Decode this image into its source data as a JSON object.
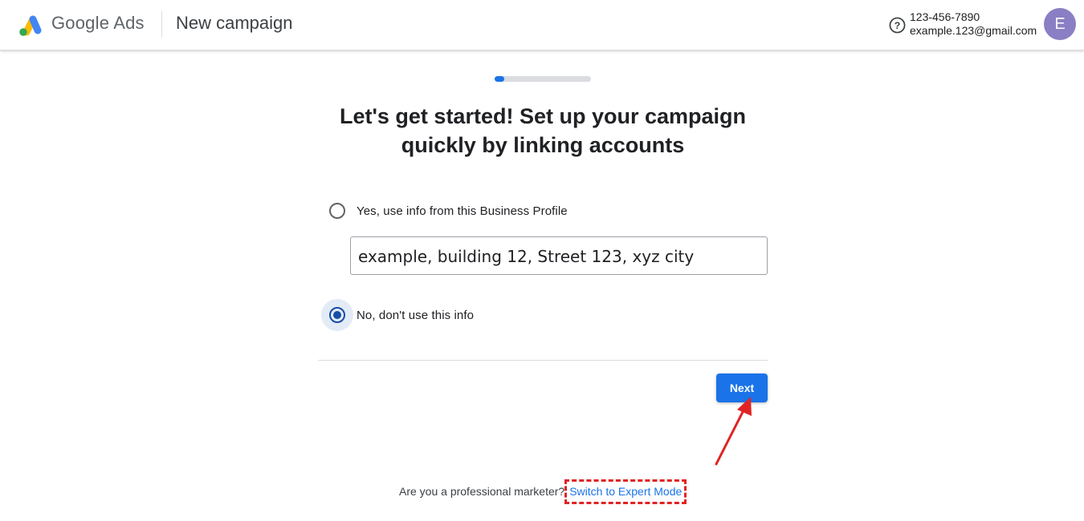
{
  "header": {
    "brand": "Google Ads",
    "page_title": "New campaign",
    "account_phone": "123-456-7890",
    "account_email": "example.123@gmail.com",
    "avatar_initial": "E"
  },
  "progress": {
    "fraction": 0.1
  },
  "main": {
    "headline_line1": "Let's get started! Set up your campaign",
    "headline_line2": "quickly by linking accounts",
    "options": [
      {
        "label": "Yes, use info from this Business Profile",
        "selected": false
      },
      {
        "label": "No, don't use this info",
        "selected": true
      }
    ],
    "business_address": "example, building 12, Street 123, xyz city",
    "next_label": "Next"
  },
  "footer": {
    "question": "Are you a professional marketer?",
    "link_label": "Switch to Expert Mode"
  },
  "colors": {
    "primary_blue": "#1a73e8",
    "annotation_red": "#e02424",
    "avatar_purple": "#8a7fc4"
  },
  "icons": {
    "logo": "google-ads-logo",
    "help": "help-circle-icon"
  }
}
